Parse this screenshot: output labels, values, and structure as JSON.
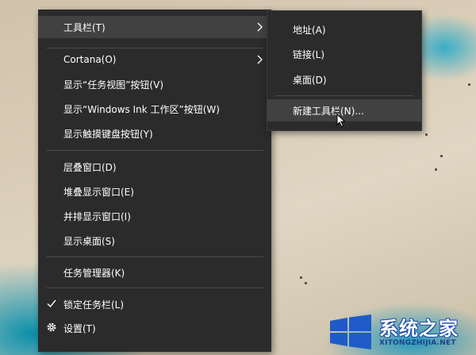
{
  "main_menu": {
    "items": [
      {
        "label": "工具栏(T)",
        "has_submenu": true,
        "hover": true
      },
      {
        "label": "Cortana(O)",
        "has_submenu": true
      },
      {
        "label": "显示“任务视图”按钮(V)"
      },
      {
        "label": "显示“Windows Ink 工作区”按钮(W)"
      },
      {
        "label": "显示触摸键盘按钮(Y)"
      },
      {
        "label": "层叠窗口(D)"
      },
      {
        "label": "堆叠显示窗口(E)"
      },
      {
        "label": "并排显示窗口(I)"
      },
      {
        "label": "显示桌面(S)"
      },
      {
        "label": "任务管理器(K)"
      },
      {
        "label": "锁定任务栏(L)",
        "checked": true
      },
      {
        "label": "设置(T)",
        "icon": "gear-icon"
      }
    ]
  },
  "toolbar_submenu": {
    "items": [
      {
        "label": "地址(A)"
      },
      {
        "label": "链接(L)"
      },
      {
        "label": "桌面(D)"
      },
      {
        "label": "新建工具栏(N)...",
        "hover": true
      }
    ]
  },
  "watermark": {
    "title": "系统之家",
    "url": "XITONGZHIJIA.NET"
  },
  "colors": {
    "menu_bg": "#2b2b2b",
    "menu_hover": "#414141",
    "menu_text": "#ffffff",
    "separator": "#4a4a4a"
  }
}
